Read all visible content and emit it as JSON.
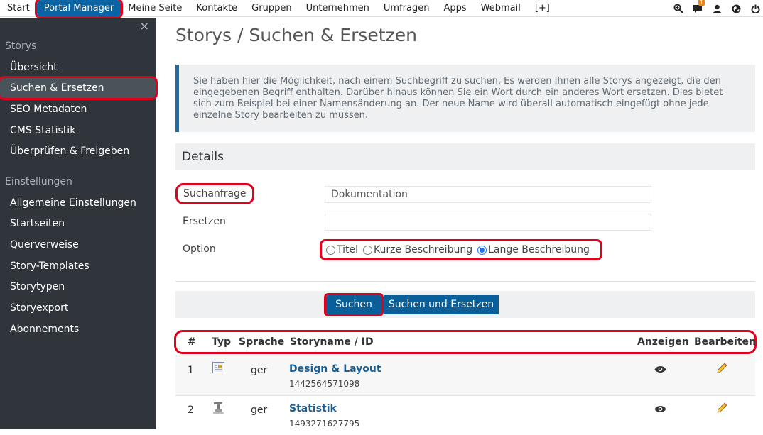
{
  "topnav": {
    "items": [
      "Start",
      "Portal Manager",
      "Meine Seite",
      "Kontakte",
      "Gruppen",
      "Unternehmen",
      "Umfragen",
      "Apps",
      "Webmail",
      "[+]"
    ],
    "notification_count": "1",
    "icons": [
      "search-icon",
      "chat-icon",
      "user-icon",
      "globe-icon",
      "power-icon"
    ]
  },
  "sidebar": {
    "close": "×",
    "group1": "Storys",
    "items1": [
      "Übersicht",
      "Suchen & Ersetzen",
      "SEO Metadaten",
      "CMS Statistik",
      "Überprüfen & Freigeben"
    ],
    "group2": "Einstellungen",
    "items2": [
      "Allgemeine Einstellungen",
      "Startseiten",
      "Querverweise",
      "Story-Templates",
      "Storytypen",
      "Storyexport",
      "Abonnements"
    ]
  },
  "page": {
    "title": "Storys / Suchen & Ersetzen",
    "info": "Sie haben hier die Möglichkeit, nach einem Suchbegriff zu suchen. Es werden Ihnen alle Storys angezeigt, die den eingegebenen Begriff enthalten. Darüber hinaus können Sie ein Wort durch ein anderes Wort ersetzen. Dies bietet sich zum Beispiel bei einer Namensänderung an. Der neue Name wird überall automatisch eingefügt ohne jede einzelne Story bearbeiten zu müssen.",
    "details_heading": "Details"
  },
  "form": {
    "query_label": "Suchanfrage",
    "query_value": "Dokumentation",
    "replace_label": "Ersetzen",
    "replace_value": "",
    "option_label": "Option",
    "options": [
      "Titel",
      "Kurze Beschreibung",
      "Lange Beschreibung"
    ],
    "selected_option": "Lange Beschreibung"
  },
  "buttons": {
    "search": "Suchen",
    "search_replace": "Suchen und Ersetzen"
  },
  "table": {
    "headers": [
      "#",
      "Typ",
      "Sprache",
      "Storyname / ID",
      "Anzeigen",
      "Bearbeiten"
    ],
    "rows": [
      {
        "num": "1",
        "lang": "ger",
        "name": "Design & Layout",
        "id": "1442564571098"
      },
      {
        "num": "2",
        "lang": "ger",
        "name": "Statistik",
        "id": "1493271627795"
      }
    ]
  },
  "colors": {
    "accent": "#0a5f9a",
    "sidebar_bg": "#2f353b",
    "highlight": "#e3001b"
  }
}
